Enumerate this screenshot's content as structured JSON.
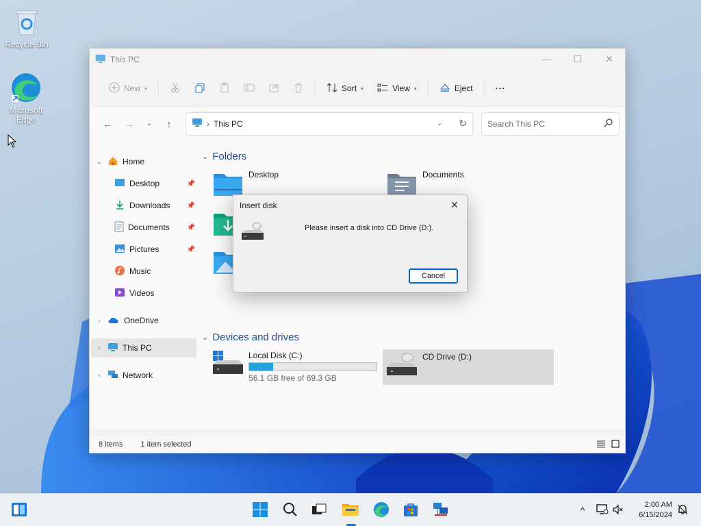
{
  "desktop": {
    "icons": [
      {
        "label": "Recycle Bin",
        "icon": "recycle-bin-icon"
      },
      {
        "label": "Microsoft Edge",
        "icon": "edge-icon"
      }
    ]
  },
  "window": {
    "title": "This PC",
    "controls": {
      "minimize": "—",
      "maximize": "☐",
      "close": "✕"
    }
  },
  "toolbar": {
    "new_label": "New",
    "sort_label": "Sort",
    "view_label": "View",
    "eject_label": "Eject",
    "more_label": "···"
  },
  "address": {
    "path": "This PC",
    "search_placeholder": "Search This PC"
  },
  "nav": {
    "home": "Home",
    "quick": [
      {
        "label": "Desktop",
        "icon": "desktop-folder-icon",
        "pinned": true
      },
      {
        "label": "Downloads",
        "icon": "download-icon",
        "pinned": true
      },
      {
        "label": "Documents",
        "icon": "documents-icon",
        "pinned": true
      },
      {
        "label": "Pictures",
        "icon": "pictures-icon",
        "pinned": true
      },
      {
        "label": "Music",
        "icon": "music-icon",
        "pinned": false
      },
      {
        "label": "Videos",
        "icon": "videos-icon",
        "pinned": false
      }
    ],
    "onedrive": "OneDrive",
    "thispc": "This PC",
    "network": "Network"
  },
  "content": {
    "folders_header": "Folders",
    "folders": [
      {
        "name": "Desktop"
      },
      {
        "name": "Documents"
      }
    ],
    "devices_header": "Devices and drives",
    "drives": [
      {
        "name": "Local Disk (C:)",
        "free_text": "56.1 GB free of 69.3 GB",
        "used_fraction": 0.19
      },
      {
        "name": "CD Drive (D:)"
      }
    ]
  },
  "status": {
    "items": "8 items",
    "selected": "1 item selected"
  },
  "dialog": {
    "title": "Insert disk",
    "message": "Please insert a disk into CD Drive (D:).",
    "cancel_label": "Cancel"
  },
  "taskbar": {
    "time": "2:00 AM",
    "date": "6/15/2024",
    "tray_chevron": "^"
  }
}
